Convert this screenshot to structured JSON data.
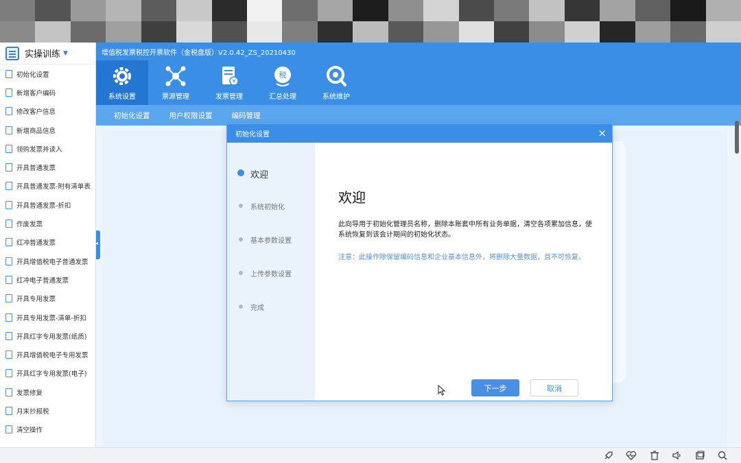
{
  "mosaic_colors": [
    "#7d7d7d",
    "#545454",
    "#9a9a9a",
    "#b5b5b5",
    "#5c5c5c",
    "#c8c8c8",
    "#2b2b2b",
    "#f2f2f2",
    "#6e6e6e",
    "#a6a6a6",
    "#1d1d1d",
    "#8f8f8f",
    "#d4d4d4",
    "#4b4b4b",
    "#7a7a7a",
    "#c2c2c2",
    "#363636",
    "#a3a3a3",
    "#606060",
    "#1a1a1a",
    "#b0b0b0",
    "#8a8a8a",
    "#c4c4c4",
    "#6b6b6b",
    "#a0a0a0",
    "#3f3f3f",
    "#d9d9d9",
    "#515151",
    "#e8e8e8",
    "#7f7f7f",
    "#2f2f2f",
    "#bcbcbc",
    "#595959",
    "#979797",
    "#e0e0e0",
    "#414141",
    "#8c8c8c",
    "#d0d0d0",
    "#262626",
    "#9e9e9e",
    "#6a6a6a",
    "#cfcfcf"
  ],
  "sidebar": {
    "title": "实操训练",
    "items": [
      "初始化设置",
      "新增客户编码",
      "修改客户信息",
      "新增商品信息",
      "领购发票并读入",
      "开具普通发票",
      "开具普通发票-附有清单表",
      "开具普通发票-折扣",
      "作废发票",
      "红冲普通发票",
      "开具增值税电子普通发票",
      "红冲电子普通发票",
      "开具专用发票",
      "开具专用发票-清单-折扣",
      "开具红字专用发票(纸质)",
      "开具增值税电子专用发票",
      "开具红字专用发票(电子)",
      "发票修复",
      "月末抄报税",
      "清空操作"
    ]
  },
  "app": {
    "title": "增值税发票税控开票软件（金税盘版）V2.0.42_ZS_20210430"
  },
  "toolbar": {
    "items": [
      {
        "label": "系统设置",
        "icon": "gear-icon",
        "active": true
      },
      {
        "label": "票源管理",
        "icon": "network-icon",
        "active": false
      },
      {
        "label": "发票管理",
        "icon": "invoice-icon",
        "active": false
      },
      {
        "label": "汇总处理",
        "icon": "tax-summary-icon",
        "active": false
      },
      {
        "label": "系统维护",
        "icon": "maintenance-icon",
        "active": false
      }
    ]
  },
  "subnav": [
    "初始化设置",
    "用户权限设置",
    "编码管理"
  ],
  "dialog": {
    "title": "初始化设置",
    "close": "×",
    "steps": [
      {
        "label": "欢迎",
        "active": true
      },
      {
        "label": "系统初始化",
        "active": false
      },
      {
        "label": "基本参数设置",
        "active": false
      },
      {
        "label": "上传参数设置",
        "active": false
      },
      {
        "label": "完成",
        "active": false
      }
    ],
    "heading": "欢迎",
    "description": "此向导用于初始化管理员名称，删除本账套中所有业务单据，清空各项累加信息，使系统恢复到该会计期间的初始化状态。",
    "note": "注意：此操作除保留编码信息和企业基本信息外，将删除大量数据，且不可恢复。",
    "next_label": "下一步",
    "cancel_label": "取消"
  },
  "taskbar": {
    "icons": [
      "rocket-icon",
      "heart-monitor-icon",
      "trash-icon",
      "speaker-icon",
      "window-icon",
      "search-icon"
    ]
  }
}
